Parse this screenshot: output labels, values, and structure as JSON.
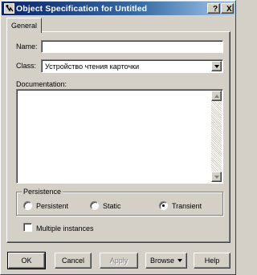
{
  "window": {
    "title": "Object Specification for Untitled",
    "help_label": "?",
    "close_label": "X"
  },
  "tabs": [
    {
      "label": "General",
      "selected": true
    }
  ],
  "form": {
    "name_label": "Name:",
    "name_value": "",
    "class_label": "Class:",
    "class_value": "Устройство чтения карточки",
    "documentation_label": "Documentation:",
    "documentation_value": ""
  },
  "persistence": {
    "title": "Persistence",
    "options": [
      {
        "label": "Persistent",
        "selected": false
      },
      {
        "label": "Static",
        "selected": false
      },
      {
        "label": "Transient",
        "selected": true
      }
    ]
  },
  "multiple_instances": {
    "label": "Multiple instances",
    "checked": false
  },
  "buttons": {
    "ok": "OK",
    "cancel": "Cancel",
    "apply": "Apply",
    "browse": "Browse",
    "help": "Help"
  },
  "colors": {
    "titlebar_start": "#0a246a",
    "titlebar_end": "#a6caf0",
    "face": "#d4d0c8"
  },
  "icons": {
    "title_icon": "object-tool-icon",
    "dropdown": "chevron-down-icon",
    "scroll_up": "chevron-up-icon",
    "scroll_down": "chevron-down-icon"
  }
}
